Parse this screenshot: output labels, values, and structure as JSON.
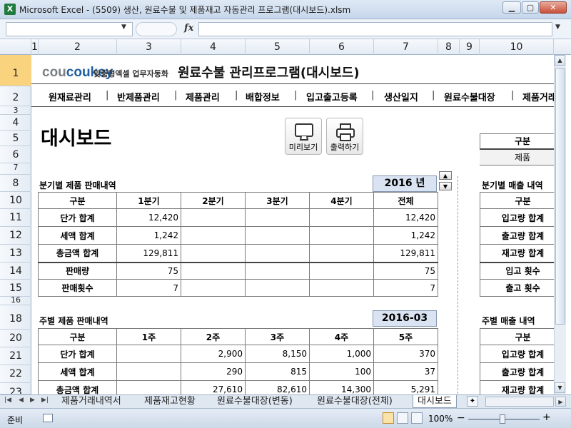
{
  "window": {
    "title": "Microsoft Excel - (5509) 생산, 원료수불 및 제품재고 자동관리 프로그램(대시보드).xlsm",
    "icon_text": "X",
    "buttons": {
      "minimize": "▁",
      "restore": "▢",
      "close": "✕"
    },
    "sub_buttons": {
      "minimize": "▁",
      "restore": "▢",
      "close": "✕"
    }
  },
  "formula_bar": {
    "name_box": "",
    "fx": "fx",
    "formula": ""
  },
  "columns": [
    "1",
    "2",
    "3",
    "4",
    "5",
    "6",
    "7",
    "8",
    "9",
    "10"
  ],
  "rows": [
    "1",
    "2",
    "3",
    "4",
    "5",
    "6",
    "7",
    "8",
    "10",
    "11",
    "12",
    "13",
    "14",
    "15",
    "16",
    "18",
    "20",
    "21",
    "22",
    "23"
  ],
  "header": {
    "logo": "coukey",
    "logo_sub": "맞춤형엑셀 업무자동화",
    "app_title": "원료수불 관리프로그램(대시보드)",
    "nav": [
      "원재료관리",
      "반제품관리",
      "제품관리",
      "배합정보",
      "입고출고등록",
      "생산일지",
      "원료수불대장",
      "제품거래"
    ],
    "separator": "|"
  },
  "dashboard": {
    "title": "대시보드",
    "preview_button": "미리보기",
    "print_button": "출력하기"
  },
  "quarterly": {
    "title": "분기별 제품 판매내역",
    "year": "2016",
    "year_unit": "년",
    "headers": [
      "구분",
      "1분기",
      "2분기",
      "3분기",
      "4분기",
      "전체"
    ],
    "rows": [
      [
        "단가 합계",
        "12,420",
        "",
        "",
        "",
        "12,420"
      ],
      [
        "세액 합계",
        "1,242",
        "",
        "",
        "",
        "1,242"
      ],
      [
        "총금액 합계",
        "129,811",
        "",
        "",
        "",
        "129,811"
      ],
      [
        "판매량",
        "75",
        "",
        "",
        "",
        "75"
      ],
      [
        "판매횟수",
        "7",
        "",
        "",
        "",
        "7"
      ]
    ]
  },
  "weekly": {
    "title": "주별 제품 판매내역",
    "month": "2016-03",
    "headers": [
      "구분",
      "1주",
      "2주",
      "3주",
      "4주",
      "5주"
    ],
    "rows": [
      [
        "단가 합계",
        "",
        "2,900",
        "8,150",
        "1,000",
        "370"
      ],
      [
        "세액 합계",
        "",
        "290",
        "815",
        "100",
        "37"
      ],
      [
        "총금액 합계",
        "",
        "27,610",
        "82,610",
        "14,300",
        "5,291"
      ]
    ]
  },
  "right_panel": {
    "gubun": "구분",
    "product": "제품",
    "quarter_title": "분기별 매출 내역",
    "quarter_header": "구분",
    "quarter_rows": [
      "입고량 합계",
      "출고량 합계",
      "재고량 합계",
      "입고 횟수",
      "출고 횟수"
    ],
    "week_title": "주별 매출 내역",
    "week_header": "구분",
    "week_rows": [
      "입고량 합계",
      "출고량 합계",
      "재고량 합계"
    ]
  },
  "sheet_tabs": [
    "제품거래내역서",
    "제품재고현황",
    "원료수불대장(변동)",
    "원료수불대장(전체)",
    "대시보드"
  ],
  "active_tab": "대시보드",
  "status": {
    "ready": "준비",
    "zoom": "100%",
    "zoom_minus": "−",
    "zoom_plus": "+"
  }
}
